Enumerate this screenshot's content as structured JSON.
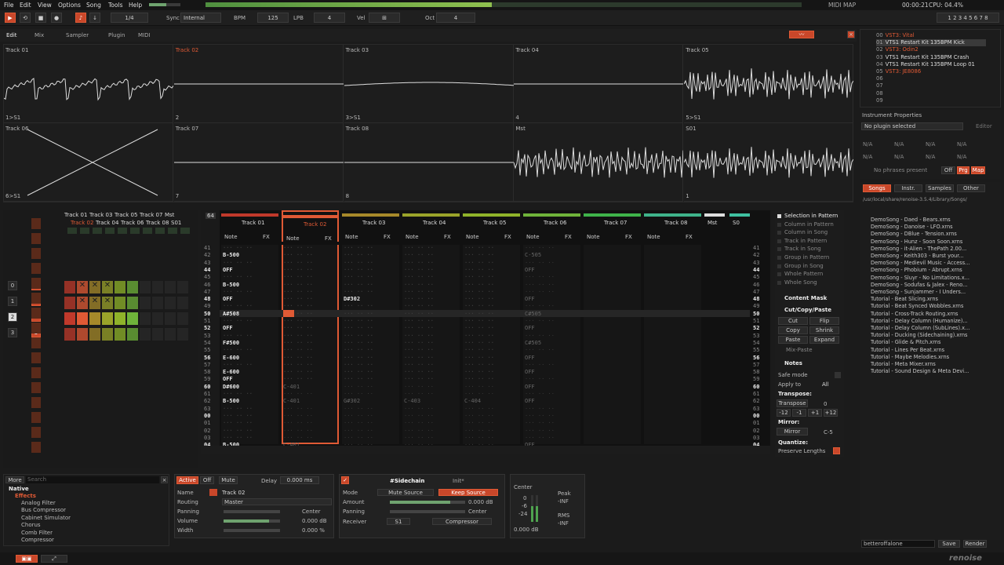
{
  "menu": {
    "items": [
      "File",
      "Edit",
      "View",
      "Options",
      "Song",
      "Tools",
      "Help"
    ],
    "status": {
      "midi": "MIDI MAP",
      "time": "00:00:21",
      "cpu": "CPU: 04.4%"
    }
  },
  "transport": {
    "pattern_div": "1/4",
    "sync_label": "Sync",
    "sync_value": "Internal",
    "bpm_label": "BPM",
    "bpm": "125",
    "lpb_label": "LPB",
    "lpb": "4",
    "vel_label": "Vel",
    "oct_label": "Oct",
    "oct": "4"
  },
  "tabs": [
    "Edit",
    "Mix",
    "Sampler",
    "Plugin",
    "MIDI"
  ],
  "scopes": [
    {
      "name": "Track 01",
      "foot": "1>S1",
      "hl": false
    },
    {
      "name": "Track 02",
      "foot": "2",
      "hl": true
    },
    {
      "name": "Track 03",
      "foot": "3>S1",
      "hl": false
    },
    {
      "name": "Track 04",
      "foot": "4",
      "hl": false
    },
    {
      "name": "Track 05",
      "foot": "5>S1",
      "hl": false
    },
    {
      "name": "Track 06",
      "foot": "6>S1",
      "hl": false
    },
    {
      "name": "Track 07",
      "foot": "7",
      "hl": false
    },
    {
      "name": "Track 08",
      "foot": "8",
      "hl": false
    },
    {
      "name": "Mst",
      "foot": "",
      "hl": false
    },
    {
      "name": "S01",
      "foot": "1",
      "hl": false
    }
  ],
  "instruments": [
    {
      "n": "00",
      "name": "VST3: Vital",
      "c": "#e05a35"
    },
    {
      "n": "01",
      "name": "VTS1 Restart Kit 135BPM Kick",
      "c": "#ddd",
      "sel": true
    },
    {
      "n": "02",
      "name": "VST3: Odin2",
      "c": "#e05a35"
    },
    {
      "n": "03",
      "name": "VTS1 Restart Kit 135BPM Crash",
      "c": "#ddd"
    },
    {
      "n": "04",
      "name": "VTS1 Restart Kit 135BPM Loop 01",
      "c": "#ddd"
    },
    {
      "n": "05",
      "name": "VST3: JE8086",
      "c": "#e05a35"
    },
    {
      "n": "06",
      "name": "",
      "c": "#ddd"
    },
    {
      "n": "07",
      "name": "",
      "c": "#ddd"
    },
    {
      "n": "08",
      "name": "",
      "c": "#ddd"
    },
    {
      "n": "09",
      "name": "",
      "c": "#ddd"
    }
  ],
  "props": {
    "title": "Instrument Properties",
    "plugin": "No plugin selected",
    "editor": "Editor",
    "na": "N/A",
    "phrases": "No phrases present",
    "off": "Off",
    "prg": "Prg",
    "map": "Map"
  },
  "browser": {
    "tabs": [
      "Songs",
      "Instr.",
      "Samples",
      "Other"
    ],
    "path": "/usr/local/share/renoise-3.5.4/Library/Songs/",
    "files": [
      "DemoSong - Daed - Bears.xrns",
      "DemoSong - Danoise - LFO.xrns",
      "DemoSong - DBlue - Tension.xrns",
      "DemoSong - Hunz - Soon Soon.xrns",
      "DemoSong - it-Alien - ThePath 2.00...",
      "DemoSong - Keith303 - Burst your...",
      "DemoSong - Medievil Music - Access...",
      "DemoSong - Phobium - Abrupt.xrns",
      "DemoSong - Sluyr - No Limitations.x...",
      "DemoSong - Sodufas & Jalex - Reno...",
      "DemoSong - Sunjammer - I Unders...",
      "Tutorial - Beat Slicing.xrns",
      "Tutorial - Beat Synced Wobbles.xrns",
      "Tutorial - Cross-Track Routing.xrns",
      "Tutorial - Delay Column (Humanize)...",
      "Tutorial - Delay Column (SubLines).x...",
      "Tutorial - Ducking (Sidechaining).xrns",
      "Tutorial - Glide & Pitch.xrns",
      "Tutorial - Lines Per Beat.xrns",
      "Tutorial - Maybe Melodies.xrns",
      "Tutorial - Meta Mixer.xrns",
      "Tutorial - Sound Design & Meta Devi..."
    ],
    "filename": "betteroffalone",
    "save": "Save",
    "render": "Render"
  },
  "matrix": {
    "tracks_top": [
      "Track 01",
      "Track 03",
      "Track 05",
      "Track 07",
      "Mst"
    ],
    "tracks_bot": [
      "Track 02",
      "Track 04",
      "Track 06",
      "Track 08",
      "S01"
    ],
    "play": "PLAY",
    "seq": [
      "0",
      "1",
      "2",
      "3"
    ],
    "seq_pat": [
      "0",
      "1",
      "2",
      "3"
    ]
  },
  "pattern": {
    "lines": "64",
    "note": "Note",
    "fx": "FX",
    "tracks": [
      {
        "name": "Track 01",
        "c": "#c0392b"
      },
      {
        "name": "Track 02",
        "c": "#e05a35",
        "sel": true
      },
      {
        "name": "Track 03",
        "c": "#a6892a"
      },
      {
        "name": "Track 04",
        "c": "#9aa32a"
      },
      {
        "name": "Track 05",
        "c": "#8fb32a"
      },
      {
        "name": "Track 06",
        "c": "#6fb33a"
      },
      {
        "name": "Track 07",
        "c": "#3fb34a"
      },
      {
        "name": "Track 08",
        "c": "#3fb38a"
      },
      {
        "name": "Mst",
        "c": "#ddd"
      },
      {
        "name": "S0",
        "c": "#3fc0a0"
      }
    ],
    "rows": [
      "41",
      "42",
      "43",
      "44",
      "45",
      "46",
      "47",
      "48",
      "49",
      "50",
      "51",
      "52",
      "53",
      "54",
      "55",
      "56",
      "57",
      "58",
      "59",
      "60",
      "61",
      "62",
      "63",
      "00",
      "01",
      "02",
      "03",
      "04"
    ],
    "t1": [
      "",
      "B-500",
      "",
      "OFF",
      "",
      "B-500",
      "",
      "OFF",
      "",
      "A#508",
      "",
      "OFF",
      "",
      "F#500",
      "",
      "E-600",
      "",
      "E-600",
      "OFF",
      "D#600",
      "",
      "B-500",
      "",
      "",
      "",
      "",
      "",
      "B-500"
    ],
    "t2": [
      "",
      "",
      "",
      "",
      "",
      "",
      "",
      "",
      "",
      "",
      "",
      "",
      "",
      "",
      "",
      "",
      "",
      "",
      "",
      "C-401",
      "",
      "C-401",
      "",
      "",
      "",
      "",
      "",
      "C-401"
    ],
    "t3": [
      "",
      "",
      "",
      "",
      "",
      "",
      "",
      "D#302",
      "",
      "",
      "",
      "",
      "",
      "",
      "",
      "",
      "",
      "",
      "",
      "",
      "",
      "G#302",
      "",
      "",
      "",
      "",
      "",
      ""
    ],
    "t4": [
      "",
      "",
      "",
      "",
      "",
      "",
      "",
      "",
      "",
      "",
      "",
      "",
      "",
      "",
      "",
      "",
      "",
      "",
      "",
      "",
      "",
      "C-403",
      "",
      "",
      "",
      "",
      "",
      ""
    ],
    "t5": [
      "",
      "",
      "",
      "",
      "",
      "",
      "",
      "",
      "",
      "",
      "",
      "",
      "",
      "",
      "",
      "",
      "",
      "",
      "",
      "",
      "",
      "C-404",
      "",
      "",
      "",
      "",
      "",
      ""
    ],
    "t6": [
      "",
      "C-505",
      "",
      "OFF",
      "",
      "",
      "",
      "OFF",
      "",
      "C#505",
      "",
      "OFF",
      "",
      "C#505",
      "",
      "OFF",
      "",
      "OFF",
      "",
      "OFF",
      "",
      "OFF",
      "",
      "",
      "",
      "",
      "",
      "OFF"
    ]
  },
  "side": {
    "sel": [
      "Selection in Pattern",
      "Column in Pattern",
      "Column in Song",
      "Track in Pattern",
      "Track in Song",
      "Group in Pattern",
      "Group in Song",
      "Whole Pattern",
      "Whole Song"
    ],
    "mask": "Content Mask",
    "ccp": "Cut/Copy/Paste",
    "cut": "Cut",
    "flip": "Flip",
    "copy": "Copy",
    "shrink": "Shrink",
    "paste": "Paste",
    "expand": "Expand",
    "mixpaste": "Mix-Paste",
    "notes": "Notes",
    "safe": "Safe mode",
    "apply": "Apply to",
    "all": "All",
    "transpose_h": "Transpose:",
    "transpose": "Transpose",
    "tval": "0",
    "m12": "-12",
    "m1": "-1",
    "p1": "+1",
    "p12": "+12",
    "mirror_h": "Mirror:",
    "mirror": "Mirror",
    "mval": "C-5",
    "quant": "Quantize:",
    "preserve": "Preserve Lengths"
  },
  "dspbrowser": {
    "more": "More",
    "search": "Search",
    "native": "Native",
    "effects": "Effects",
    "items": [
      "Analog Filter",
      "Bus Compressor",
      "Cabinet Simulator",
      "Chorus",
      "Comb Filter",
      "Compressor"
    ]
  },
  "trackdsp": {
    "active": "Active",
    "off": "Off",
    "mute": "Mute",
    "delay": "Delay",
    "delayval": "0.000 ms",
    "name_l": "Name",
    "name": "Track 02",
    "routing_l": "Routing",
    "routing": "Master",
    "pan_l": "Panning",
    "pan": "Center",
    "vol_l": "Volume",
    "vol": "0.000 dB",
    "width_l": "Width",
    "width": "0.000 %"
  },
  "sidechain": {
    "title": "#Sidechain",
    "init": "Init*",
    "mode": "Mode",
    "mute": "Mute Source",
    "keep": "Keep Source",
    "amount": "Amount",
    "amountv": "0.000 dB",
    "pan": "Panning",
    "panv": "Center",
    "recv": "Receiver",
    "recvv": "S1",
    "comp": "Compressor"
  },
  "meter": {
    "center": "Center",
    "peak": "Peak",
    "peakv": "-INF",
    "rms": "RMS",
    "rmsv": "-INF",
    "db": "0.000 dB",
    "scale": [
      "0",
      "-6",
      "-24"
    ]
  },
  "statusbar": {
    "logo": "renoise"
  }
}
